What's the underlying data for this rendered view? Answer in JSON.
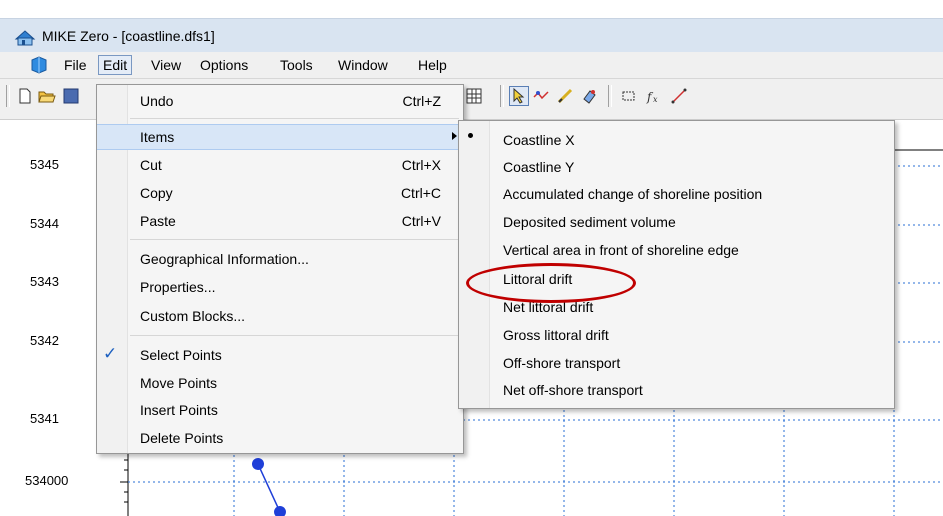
{
  "window": {
    "title": "MIKE Zero - [coastline.dfs1]"
  },
  "menubar": {
    "items": [
      {
        "label": "File"
      },
      {
        "label": "Edit"
      },
      {
        "label": "View"
      },
      {
        "label": "Options"
      },
      {
        "label": "Tools"
      },
      {
        "label": "Window"
      },
      {
        "label": "Help"
      }
    ]
  },
  "plot": {
    "y_tick_labels": [
      "5345",
      "5344",
      "5343",
      "5342",
      "5341",
      "534000"
    ]
  },
  "edit_menu": {
    "items": [
      {
        "label": "Undo",
        "shortcut": "Ctrl+Z"
      },
      {
        "label": "Items"
      },
      {
        "label": "Cut",
        "shortcut": "Ctrl+X"
      },
      {
        "label": "Copy",
        "shortcut": "Ctrl+C"
      },
      {
        "label": "Paste",
        "shortcut": "Ctrl+V"
      },
      {
        "label": "Geographical Information..."
      },
      {
        "label": "Properties..."
      },
      {
        "label": "Custom Blocks..."
      },
      {
        "label": "Select Points",
        "checked": true
      },
      {
        "label": "Move Points"
      },
      {
        "label": "Insert Points"
      },
      {
        "label": "Delete Points"
      }
    ]
  },
  "items_submenu": {
    "items": [
      {
        "label": "Coastline X",
        "selected": true
      },
      {
        "label": "Coastline Y"
      },
      {
        "label": "Accumulated change of shoreline position"
      },
      {
        "label": "Deposited sediment volume"
      },
      {
        "label": "Vertical area in front of shoreline edge"
      },
      {
        "label": "Littoral drift",
        "highlighted": true
      },
      {
        "label": "Net littoral drift"
      },
      {
        "label": "Gross littoral drift"
      },
      {
        "label": "Off-shore transport"
      },
      {
        "label": "Net off-shore transport"
      }
    ]
  },
  "colors": {
    "highlight_ellipse": "#c00000",
    "series_line": "#1f3fd8",
    "grid": "#2a6fd6",
    "check": "#1d60c0"
  }
}
